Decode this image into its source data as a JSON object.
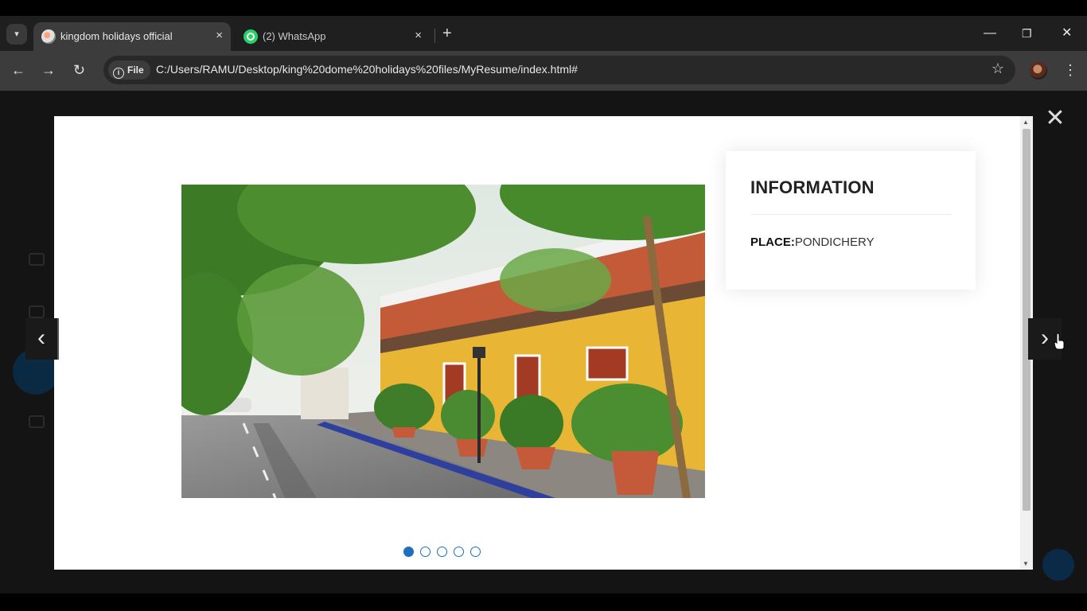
{
  "browser": {
    "tabs": [
      {
        "title": "kingdom holidays official",
        "active": true,
        "favicon": "kingdom-holidays-favicon"
      },
      {
        "title": "(2) WhatsApp",
        "active": false,
        "favicon": "whatsapp-icon"
      }
    ],
    "new_tab_label": "+",
    "tab_close_label": "×",
    "window_controls": {
      "minimize": "—",
      "restore": "❐",
      "close": "✕"
    },
    "nav": {
      "back": "←",
      "forward": "→",
      "reload": "↻"
    },
    "address": {
      "chip_label": "File",
      "url": "C:/Users/RAMU/Desktop/king%20dome%20holidays%20files/MyResume/index.html#"
    },
    "bookmark_icon": "star-icon",
    "menu_icon": "⋮"
  },
  "lightbox": {
    "close_label": "✕",
    "prev_label": "‹",
    "next_label": "›",
    "info": {
      "title": "INFORMATION",
      "place_label": "PLACE:",
      "place_value": "PONDICHERY"
    },
    "slides": {
      "count": 5,
      "active_index": 0
    },
    "image_description_icon": "photo-pondicherry-street"
  },
  "colors": {
    "accent": "#1e6fc0",
    "tab_active": "#3c3c3c",
    "toolbar": "#3c3c3c"
  }
}
